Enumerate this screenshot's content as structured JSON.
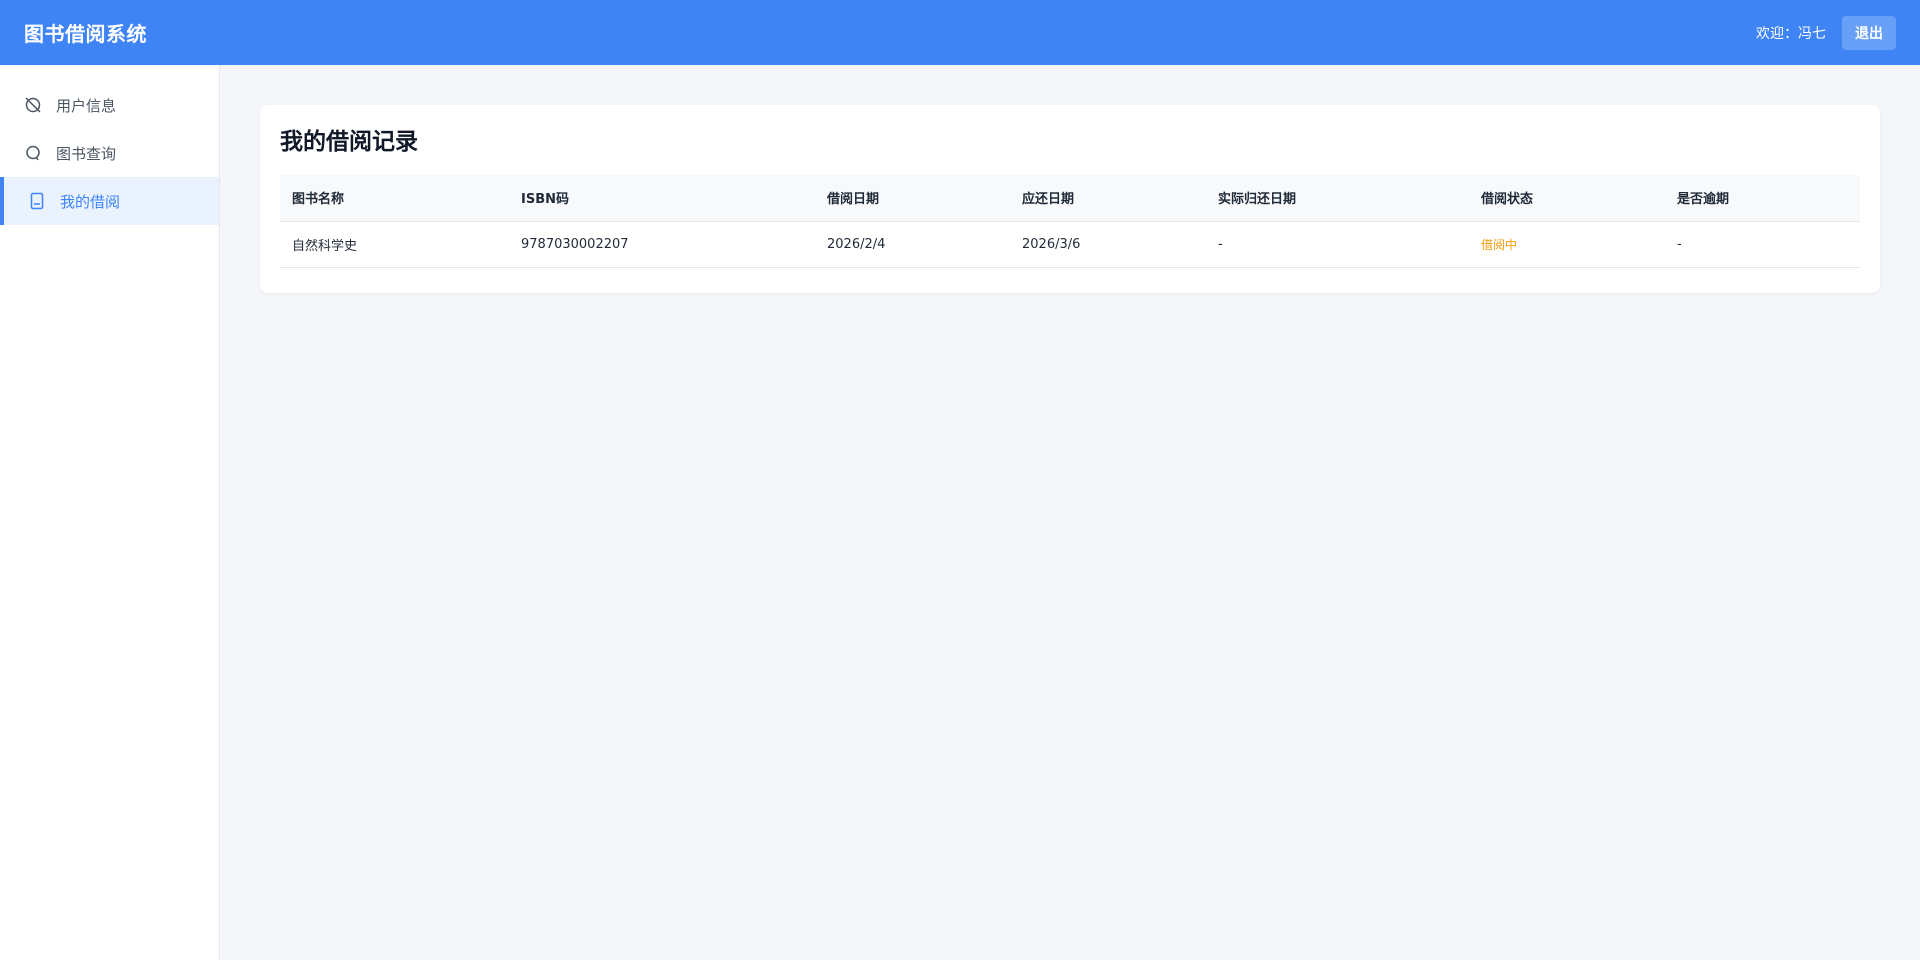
{
  "header": {
    "title": "图书借阅系统",
    "welcome": "欢迎：冯七",
    "logout_label": "退出"
  },
  "sidebar": {
    "items": [
      {
        "label": "用户信息",
        "icon": "user-info-icon",
        "active": false
      },
      {
        "label": "图书查询",
        "icon": "search-icon",
        "active": false
      },
      {
        "label": "我的借阅",
        "icon": "book-icon",
        "active": true
      }
    ]
  },
  "main": {
    "title": "我的借阅记录",
    "table": {
      "columns": [
        "图书名称",
        "ISBN码",
        "借阅日期",
        "应还日期",
        "实际归还日期",
        "借阅状态",
        "是否逾期"
      ],
      "rows": [
        [
          "自然科学史",
          "9787030002207",
          "2026/2/4",
          "2026/3/6",
          "-",
          "借阅中",
          "-"
        ]
      ]
    }
  },
  "colors": {
    "brand": "#3e84f5",
    "status_borrowing": "#f59e0b",
    "active_bg": "#eaf2fe"
  }
}
